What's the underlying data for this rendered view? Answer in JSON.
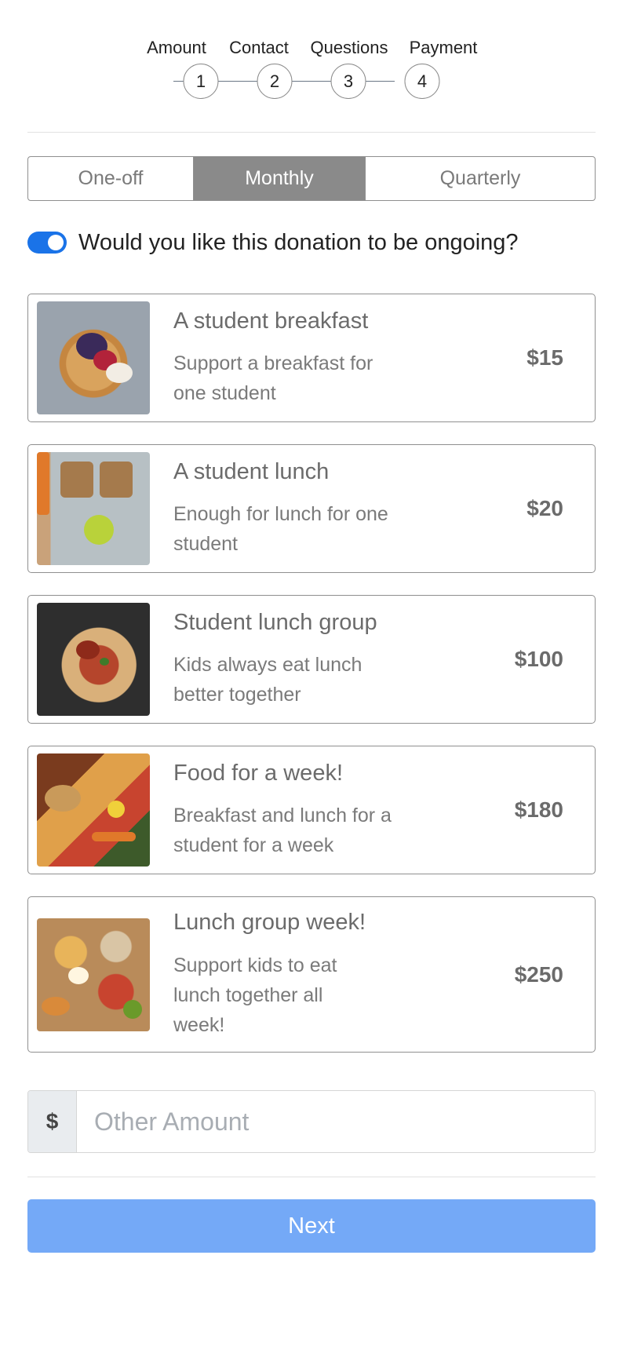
{
  "stepper": {
    "steps": [
      {
        "label": "Amount",
        "number": "1"
      },
      {
        "label": "Contact",
        "number": "2"
      },
      {
        "label": "Questions",
        "number": "3"
      },
      {
        "label": "Payment",
        "number": "4"
      }
    ]
  },
  "frequency": {
    "tabs": [
      {
        "label": "One-off",
        "active": false
      },
      {
        "label": "Monthly",
        "active": true
      },
      {
        "label": "Quarterly",
        "active": false
      }
    ]
  },
  "ongoing": {
    "label": "Would you like this donation to be ongoing?",
    "enabled": true,
    "toggle_color": "#1a73e8"
  },
  "options": [
    {
      "title": "A student breakfast",
      "description": "Support a breakfast for one student",
      "price": "$15",
      "image": "pancakes-with-berries"
    },
    {
      "title": "A student lunch",
      "description": "Enough for lunch for one student",
      "price": "$20",
      "image": "lunch-tray-sandwich"
    },
    {
      "title": "Student lunch group",
      "description": "Kids always eat lunch better together",
      "price": "$100",
      "image": "pasta-plate"
    },
    {
      "title": "Food for a week!",
      "description": "Breakfast and lunch for a student for a week",
      "price": "$180",
      "image": "assorted-groceries"
    },
    {
      "title": "Lunch group week!",
      "description": "Support kids to eat lunch together all week!",
      "price": "$250",
      "image": "breakfast-spread"
    }
  ],
  "other_amount": {
    "currency_symbol": "$",
    "placeholder": "Other Amount",
    "value": ""
  },
  "next_button": {
    "label": "Next",
    "color": "#74a9f7"
  }
}
